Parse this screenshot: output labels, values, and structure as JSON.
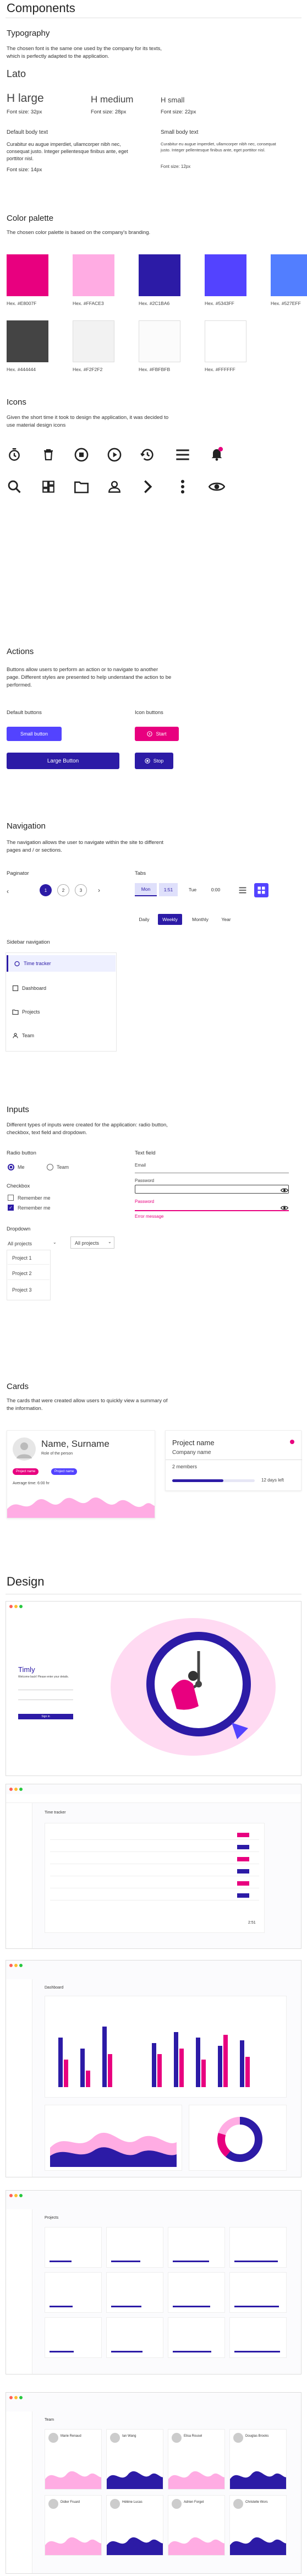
{
  "components": {
    "title": "Components"
  },
  "typography": {
    "title": "Typography",
    "desc": "The chosen font is the same one used by the company for its texts, which is perfectly adapted to the application.",
    "font_name": "Lato",
    "h_large": "H large",
    "h_large_size": "Font size: 32px",
    "h_medium": "H medium",
    "h_medium_size": "Font size: 28px",
    "h_small": "H small",
    "h_small_size": "Font size: 22px",
    "default_title": "Default body text",
    "default_text": "Curabitur eu augue imperdiet, ullamcorper nibh nec, consequat justo. Integer pellentesque finibus ante, eget porttitor nisl.",
    "default_size": "Font size: 14px",
    "small_title": "Small body text",
    "small_text": "Curabitur eu augue imperdiet, ullamcorper nibh nec, consequat justo. Integer pellentesque finibus ante, eget porttitor nisl.",
    "small_size": "Font size: 12px"
  },
  "palette": {
    "title": "Color palette",
    "desc": "The chosen color palette is based on the company's branding.",
    "colors": [
      {
        "hex": "#E8007F",
        "label": "Hex. #E8007F"
      },
      {
        "hex": "#FFACE3",
        "label": "Hex. #FFACE3"
      },
      {
        "hex": "#2C1BA6",
        "label": "Hex. #2C1BA6"
      },
      {
        "hex": "#5343FF",
        "label": "Hex. #5343FF"
      },
      {
        "hex": "#527EFF",
        "label": "Hex. #527EFF"
      },
      {
        "hex": "#444444",
        "label": "Hex. #444444"
      },
      {
        "hex": "#F2F2F2",
        "label": "Hex. #F2F2F2"
      },
      {
        "hex": "#FBFBFB",
        "label": "Hex. #FBFBFB"
      },
      {
        "hex": "#FFFFFF",
        "label": "Hex. #FFFFFF"
      }
    ]
  },
  "icons": {
    "title": "Icons",
    "desc": "Given the short time it took to design the application, it was decided to use material design icons",
    "row1": [
      "time-icon",
      "delete-icon",
      "stop-circle-icon",
      "play-circle-icon",
      "history-icon",
      "menu-icon",
      "notification-bell-icon"
    ],
    "row2": [
      "search-icon",
      "dashboard-icon",
      "folder-icon",
      "person-icon",
      "chevron-right-icon",
      "more-vert-icon",
      "visibility-icon"
    ]
  },
  "actions": {
    "title": "Actions",
    "desc": "Buttons allow users to perform an action or to navigate to another page. Different styles are presented to help understand the action to be performed.",
    "default_title": "Default buttons",
    "icon_title": "Icon buttons",
    "small_button": "Small button",
    "large_button": "Large Button",
    "start": "Start",
    "stop": "Stop"
  },
  "navigation": {
    "title": "Navigation",
    "desc": "The navigation allows the user to navigate within the site to different pages and / or sections.",
    "paginator_title": "Paginator",
    "pages": [
      "1",
      "2",
      "3"
    ],
    "tabs_title": "Tabs",
    "tabs1": [
      "Mon",
      "1:51",
      "Tue",
      "0:00"
    ],
    "tabs2": [
      "Daily",
      "Weekly",
      "Monthly",
      "Year"
    ],
    "sidebar_title": "Sidebar navigation",
    "sidebar": [
      "Time tracker",
      "Dashboard",
      "Projects",
      "Team"
    ]
  },
  "inputs": {
    "title": "Inputs",
    "desc": "Different types of inputs were created for the application: radio button, checkbox, text field and dropdown.",
    "radio_title": "Radio button",
    "radio": [
      "Me",
      "Team"
    ],
    "checkbox_title": "Checkbox",
    "checkbox": [
      "Remember me",
      "Remember me"
    ],
    "text_title": "Text field",
    "email": "Email",
    "password": "Password",
    "password_err": "Password",
    "error_msg": "Error message",
    "dropdown_title": "Dropdown",
    "dropdown": "All projects",
    "dropdown2": "All projects",
    "dropdown_items": [
      "Project 1",
      "Project 2",
      "Project 3"
    ]
  },
  "cards": {
    "title": "Cards",
    "desc": "The cards that were created allow users to quickly view a summary of the information.",
    "name": "Name, Surname",
    "role": "Role of the person",
    "badge1": "Project name",
    "badge2": "Project name",
    "avg": "Average time: 6:00 hr",
    "project_name": "Project name",
    "company": "Company name",
    "members": "2 members",
    "days_left": "12 days left",
    "progress": 0.62
  },
  "design": {
    "title": "Design",
    "login_logo": "Timly",
    "login_sub": "Welcome back! Please enter your details.",
    "login_btn": "Sign in",
    "tracker_title": "Time tracker",
    "tracker_total": "2:51",
    "dashboard_title": "Dashboard",
    "projects_title": "Projects",
    "team_title": "Team",
    "team_names": [
      "Marie Renaud",
      "Ian Wang",
      "Elisa Rousel",
      "Douglas Brooks",
      "Didier Fruard",
      "Hélène Lucas",
      "Adrien Forget",
      "Christelle Wors"
    ]
  }
}
